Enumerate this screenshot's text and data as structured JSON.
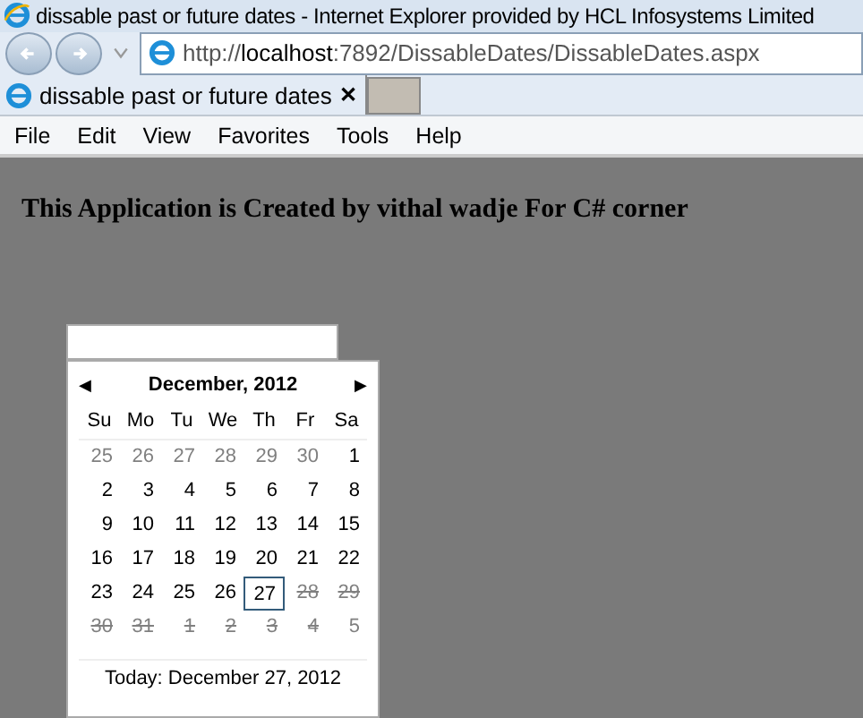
{
  "window": {
    "title": "dissable past or future dates - Internet Explorer provided by HCL Infosystems Limited"
  },
  "address_bar": {
    "url_prefix": "http://",
    "url_host": "localhost",
    "url_rest": ":7892/DissableDates/DissableDates.aspx"
  },
  "tabs": [
    {
      "label": "dissable past or future dates",
      "close": "✕"
    }
  ],
  "menu": [
    "File",
    "Edit",
    "View",
    "Favorites",
    "Tools",
    "Help"
  ],
  "page": {
    "heading": "This Application is Created by vithal wadje For C# corner",
    "calendar": {
      "prev": "◀",
      "next": "▶",
      "month": "December, 2012",
      "weekdays": [
        "Su",
        "Mo",
        "Tu",
        "We",
        "Th",
        "Fr",
        "Sa"
      ],
      "days": [
        {
          "text": "25",
          "kind": "other",
          "today": false
        },
        {
          "text": "26",
          "kind": "other",
          "today": false
        },
        {
          "text": "27",
          "kind": "other",
          "today": false
        },
        {
          "text": "28",
          "kind": "other",
          "today": false
        },
        {
          "text": "29",
          "kind": "other",
          "today": false
        },
        {
          "text": "30",
          "kind": "other",
          "today": false
        },
        {
          "text": "1",
          "kind": "normal",
          "today": false
        },
        {
          "text": "2",
          "kind": "normal",
          "today": false
        },
        {
          "text": "3",
          "kind": "normal",
          "today": false
        },
        {
          "text": "4",
          "kind": "normal",
          "today": false
        },
        {
          "text": "5",
          "kind": "normal",
          "today": false
        },
        {
          "text": "6",
          "kind": "normal",
          "today": false
        },
        {
          "text": "7",
          "kind": "normal",
          "today": false
        },
        {
          "text": "8",
          "kind": "normal",
          "today": false
        },
        {
          "text": "9",
          "kind": "normal",
          "today": false
        },
        {
          "text": "10",
          "kind": "normal",
          "today": false
        },
        {
          "text": "11",
          "kind": "normal",
          "today": false
        },
        {
          "text": "12",
          "kind": "normal",
          "today": false
        },
        {
          "text": "13",
          "kind": "normal",
          "today": false
        },
        {
          "text": "14",
          "kind": "normal",
          "today": false
        },
        {
          "text": "15",
          "kind": "normal",
          "today": false
        },
        {
          "text": "16",
          "kind": "normal",
          "today": false
        },
        {
          "text": "17",
          "kind": "normal",
          "today": false
        },
        {
          "text": "18",
          "kind": "normal",
          "today": false
        },
        {
          "text": "19",
          "kind": "normal",
          "today": false
        },
        {
          "text": "20",
          "kind": "normal",
          "today": false
        },
        {
          "text": "21",
          "kind": "normal",
          "today": false
        },
        {
          "text": "22",
          "kind": "normal",
          "today": false
        },
        {
          "text": "23",
          "kind": "normal",
          "today": false
        },
        {
          "text": "24",
          "kind": "normal",
          "today": false
        },
        {
          "text": "25",
          "kind": "normal",
          "today": false
        },
        {
          "text": "26",
          "kind": "normal",
          "today": false
        },
        {
          "text": "27",
          "kind": "normal",
          "today": true
        },
        {
          "text": "28",
          "kind": "disabled",
          "today": false
        },
        {
          "text": "29",
          "kind": "disabled",
          "today": false
        },
        {
          "text": "30",
          "kind": "disabled",
          "today": false
        },
        {
          "text": "31",
          "kind": "disabled",
          "today": false
        },
        {
          "text": "1",
          "kind": "disabled",
          "today": false
        },
        {
          "text": "2",
          "kind": "disabled",
          "today": false
        },
        {
          "text": "3",
          "kind": "disabled",
          "today": false
        },
        {
          "text": "4",
          "kind": "disabled",
          "today": false
        },
        {
          "text": "5",
          "kind": "other",
          "today": false
        }
      ],
      "today_label": "Today: December 27, 2012"
    }
  }
}
